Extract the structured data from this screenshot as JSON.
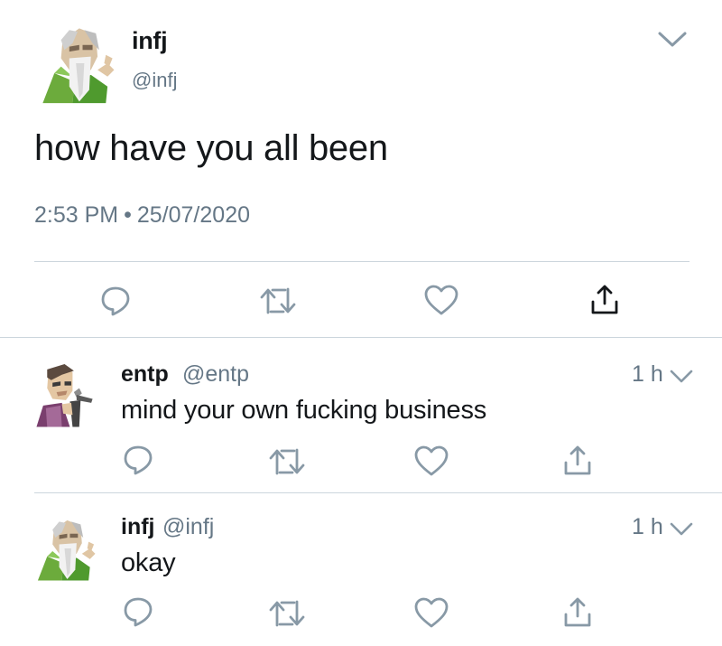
{
  "main_tweet": {
    "name": "infj",
    "handle": "@infj",
    "text": "how have you all been",
    "time": "2:53 PM",
    "separator": "•",
    "date": "25/07/2020",
    "avatar_icon": "old-wizard-avatar"
  },
  "replies": [
    {
      "name": "entp",
      "handle": "@entp",
      "time": "1 h",
      "text": "mind your own fucking business",
      "avatar_icon": "debater-avatar"
    },
    {
      "name": "infj",
      "handle": "@infj",
      "time": "1 h",
      "text": "okay",
      "avatar_icon": "old-wizard-avatar"
    }
  ],
  "icons": [
    "reply-icon",
    "retweet-icon",
    "like-icon",
    "share-icon",
    "chevron-down-icon"
  ],
  "colors": {
    "text": "#14171a",
    "secondary": "#657786",
    "icon": "#8899a6",
    "divider": "#ccd6dd"
  }
}
